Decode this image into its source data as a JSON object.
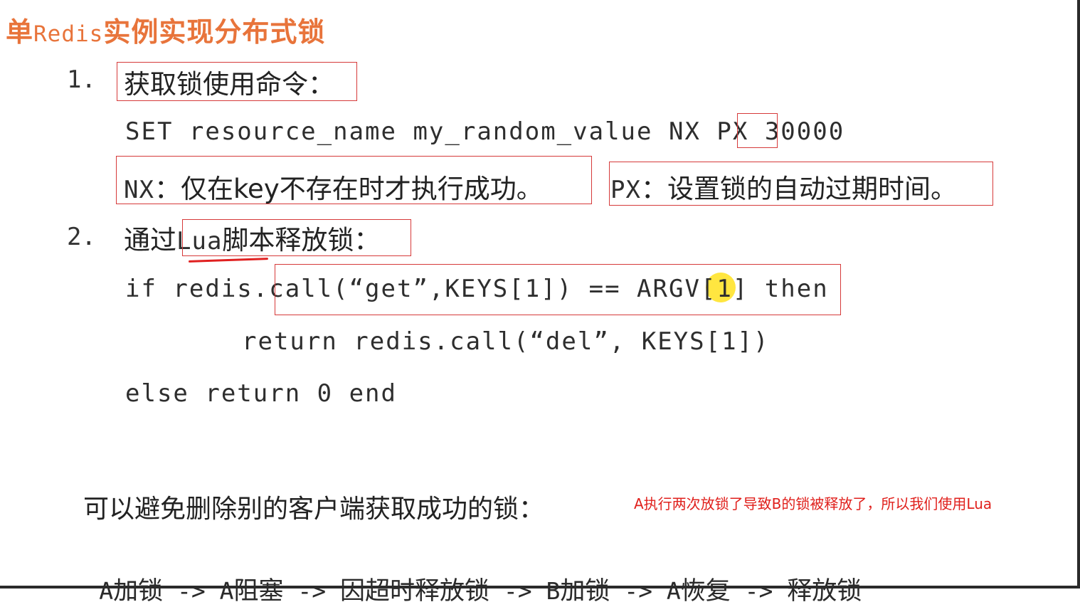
{
  "title": {
    "prefix": "单",
    "mono": "Redis",
    "suffix": "实例实现分布式锁"
  },
  "step1": {
    "num": "1.",
    "heading": "获取锁使用命令：",
    "code_before": "SET resource_name my_random_value ",
    "code_nx": "NX",
    "code_after": " PX 30000",
    "nx_mono": "NX",
    "nx_desc": "：仅在key不存在时才执行成功。",
    "px_mono": "PX",
    "px_desc": "：设置锁的自动过期时间。"
  },
  "step2": {
    "num": "2.",
    "heading_prefix": "通过",
    "heading_mono": "Lua",
    "heading_suffix": "脚本释放锁：",
    "line1_start": "if redis",
    "line1_boxed": ".call(“get”,KEYS[1]) == ARGV[1]",
    "line1_end": " then",
    "line2": "return redis.call(“del”, KEYS[1])",
    "line3": "else return 0 end"
  },
  "summary": "可以避免删除别的客户端获取成功的锁：",
  "annotation": "A执行两次放锁了导致B的锁被释放了，所以我们使用Lua",
  "flow": [
    {
      "mono": "A",
      "text": "加锁"
    },
    {
      "mono": " -> A",
      "text": "阻塞"
    },
    {
      "mono": " -> ",
      "text": "因超时释放锁"
    },
    {
      "mono": " -> B",
      "text": "加锁"
    },
    {
      "mono": " -> A",
      "text": "恢复"
    },
    {
      "mono": " -> ",
      "text": "释放锁"
    }
  ]
}
